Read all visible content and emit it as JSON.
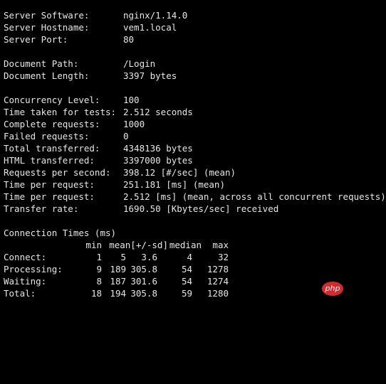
{
  "terminal": {
    "lines": [
      {
        "label": "Server Software:",
        "value": "nginx/1.14.0"
      },
      {
        "label": "Server Hostname:",
        "value": "vem1.local"
      },
      {
        "label": "Server Port:",
        "value": "80"
      },
      {
        "label": "Document Path:",
        "value": "/Login"
      },
      {
        "label": "Document Length:",
        "value": "3397 bytes"
      },
      {
        "label": "Concurrency Level:",
        "value": "100"
      },
      {
        "label": "Time taken for tests:",
        "value": "2.512 seconds"
      },
      {
        "label": "Complete requests:",
        "value": "1000"
      },
      {
        "label": "Failed requests:",
        "value": "0"
      },
      {
        "label": "Total transferred:",
        "value": "4348136 bytes"
      },
      {
        "label": "HTML transferred:",
        "value": "3397000 bytes"
      },
      {
        "label": "Requests per second:",
        "value": "398.12 [#/sec] (mean)"
      },
      {
        "label": "Time per request:",
        "value": "251.181 [ms] (mean)"
      },
      {
        "label": "Time per request:",
        "value": "2.512 [ms] (mean, across all concurrent requests)"
      },
      {
        "label": "Transfer rate:",
        "value": "1690.50 [Kbytes/sec] received"
      }
    ],
    "connection_times": {
      "title": "Connection Times (ms)",
      "headers": [
        "min",
        "mean[+/-sd]",
        "median",
        "max"
      ],
      "rows": [
        {
          "label": "Connect:",
          "min": "1",
          "mean": "5",
          "sd": "3.6",
          "median": "4",
          "max": "32"
        },
        {
          "label": "Processing:",
          "min": "9",
          "mean": "189",
          "sd": "305.8",
          "median": "54",
          "max": "1278"
        },
        {
          "label": "Waiting:",
          "min": "8",
          "mean": "187",
          "sd": "301.6",
          "median": "54",
          "max": "1274"
        },
        {
          "label": "Total:",
          "min": "18",
          "mean": "194",
          "sd": "305.8",
          "median": "59",
          "max": "1280"
        }
      ]
    }
  },
  "watermark": {
    "text": "php"
  }
}
